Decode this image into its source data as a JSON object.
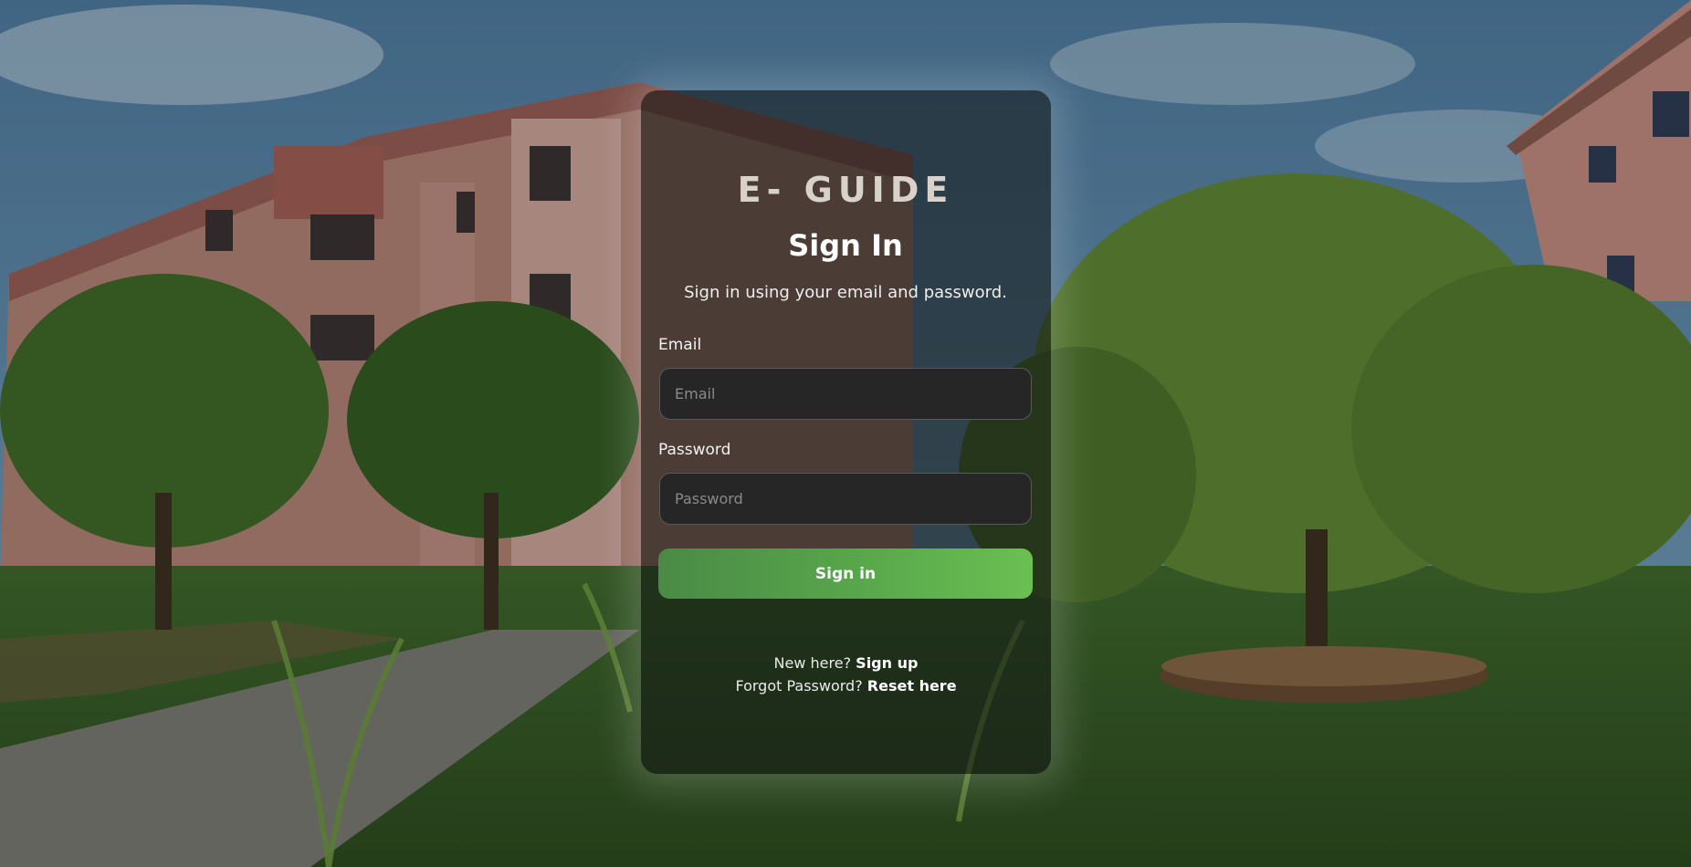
{
  "app": {
    "brand": "E- GUIDE",
    "heading": "Sign In",
    "subtitle": "Sign in using your email and password."
  },
  "form": {
    "email_label": "Email",
    "email_placeholder": "Email",
    "email_value": "",
    "password_label": "Password",
    "password_placeholder": "Password",
    "password_value": "",
    "submit_label": "Sign in"
  },
  "footer": {
    "signup_prompt": "New here?",
    "signup_link": "Sign up",
    "reset_prompt": "Forgot Password?",
    "reset_link": "Reset here"
  },
  "colors": {
    "card_background": "#121614",
    "input_background": "#262626",
    "button_gradient_start": "#4a8a46",
    "button_gradient_end": "#6bbf52",
    "text": "#ffffff"
  }
}
